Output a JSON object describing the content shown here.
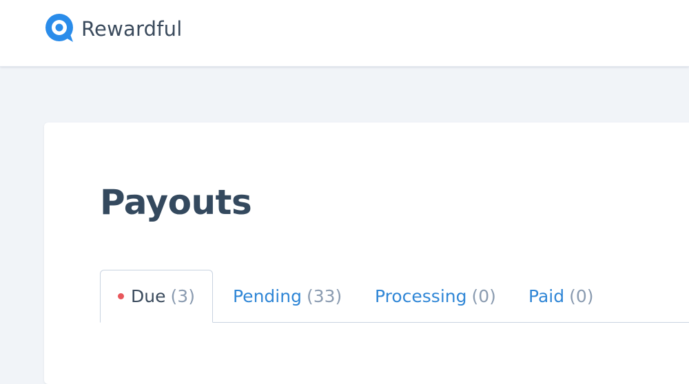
{
  "header": {
    "brand_name": "Rewardful",
    "logo_icon": "rewardful-logo-icon",
    "logo_color": "#2a8cea"
  },
  "main": {
    "page_title": "Payouts",
    "tabs": [
      {
        "label": "Due",
        "count": "(3)",
        "active": true,
        "indicator_color": "#e8575c"
      },
      {
        "label": "Pending",
        "count": "(33)",
        "active": false
      },
      {
        "label": "Processing",
        "count": "(0)",
        "active": false
      },
      {
        "label": "Paid",
        "count": "(0)",
        "active": false
      }
    ]
  },
  "colors": {
    "link": "#2f86d6",
    "title": "#34495e",
    "count": "#8a9bb0",
    "background": "#f1f4f8"
  }
}
